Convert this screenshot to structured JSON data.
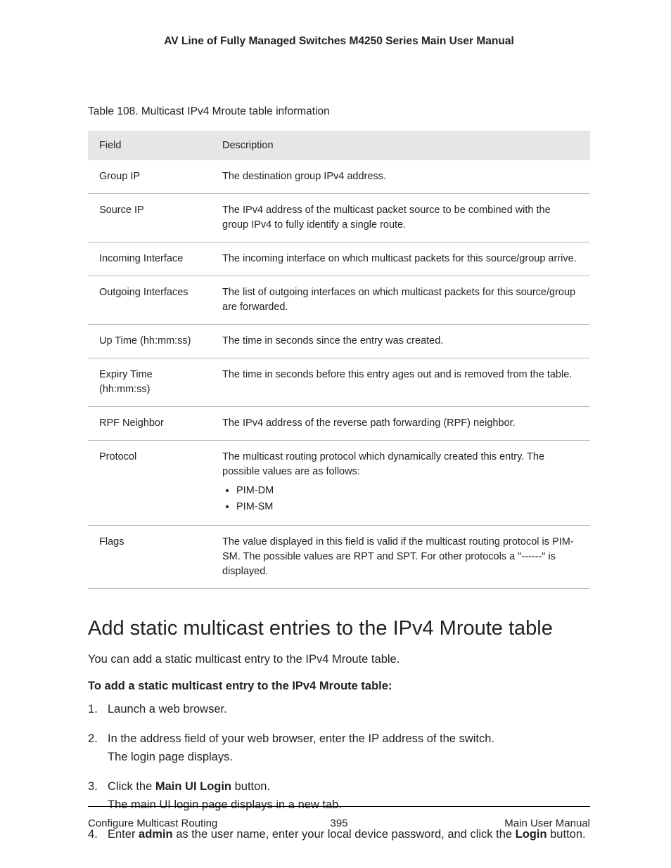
{
  "header": {
    "title": "AV Line of Fully Managed Switches M4250 Series Main User Manual"
  },
  "table": {
    "caption": "Table 108. Multicast IPv4 Mroute table information",
    "head": {
      "field": "Field",
      "desc": "Description"
    },
    "rows": [
      {
        "field": "Group IP",
        "desc": "The destination group IPv4 address."
      },
      {
        "field": "Source IP",
        "desc": "The IPv4 address of the multicast packet source to be combined with the group IPv4 to fully identify a single route."
      },
      {
        "field": "Incoming Interface",
        "desc": "The incoming interface on which multicast packets for this source/group arrive."
      },
      {
        "field": "Outgoing Interfaces",
        "desc": "The list of outgoing interfaces on which multicast packets for this source/group are forwarded."
      },
      {
        "field": "Up Time (hh:mm:ss)",
        "desc": "The time in seconds since the entry was created."
      },
      {
        "field": "Expiry Time (hh:mm:ss)",
        "desc": "The time in seconds before this entry ages out and is removed from the table."
      },
      {
        "field": "RPF Neighbor",
        "desc": "The IPv4 address of the reverse path forwarding (RPF) neighbor."
      },
      {
        "field": "Protocol",
        "desc_pre": "The multicast routing protocol which dynamically created this entry. The possible values are as follows:",
        "list": [
          "PIM-DM",
          "PIM-SM"
        ]
      },
      {
        "field": "Flags",
        "desc": "The value displayed in this field is valid if the multicast routing protocol is PIM-SM. The possible values are RPT and SPT. For other protocols a \"------\" is displayed."
      }
    ]
  },
  "section": {
    "heading": "Add static multicast entries to the IPv4 Mroute table",
    "intro": "You can add a static multicast entry to the IPv4 Mroute table.",
    "bold_intro": "To add a static multicast entry to the IPv4 Mroute table:",
    "steps": {
      "s1": "Launch a web browser.",
      "s2a": "In the address field of your web browser, enter the IP address of the switch.",
      "s2b": "The login page displays.",
      "s3a_pre": "Click the ",
      "s3a_bold": "Main UI Login",
      "s3a_post": " button.",
      "s3b": "The main UI login page displays in a new tab.",
      "s4_pre": "Enter ",
      "s4_bold1": "admin",
      "s4_mid": " as the user name, enter your local device password, and click the ",
      "s4_bold2": "Login",
      "s4_post": " button."
    }
  },
  "footer": {
    "left": "Configure Multicast Routing",
    "center": "395",
    "right": "Main User Manual"
  }
}
